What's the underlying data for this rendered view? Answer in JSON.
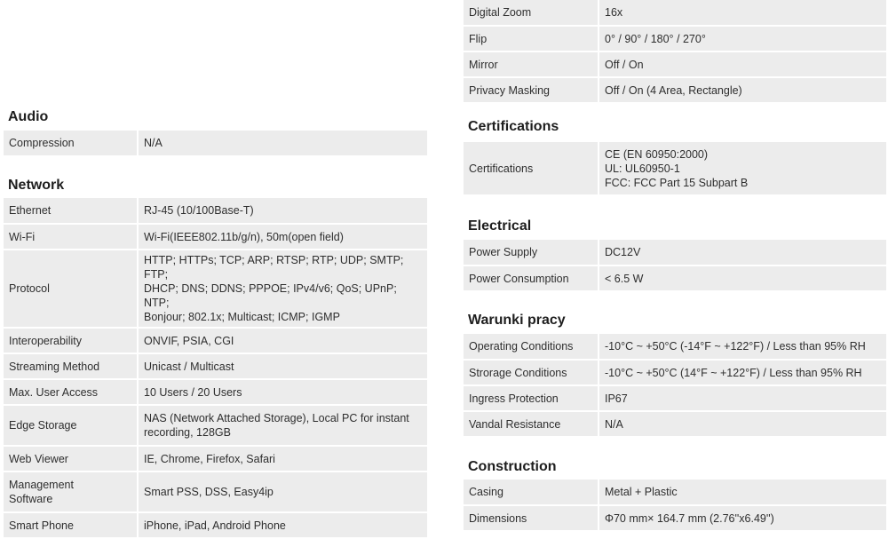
{
  "left": {
    "audio": {
      "title": "Audio",
      "rows": [
        {
          "label": "Compression",
          "value": "N/A"
        }
      ]
    },
    "network": {
      "title": "Network",
      "rows": [
        {
          "label": "Ethernet",
          "value": "RJ-45 (10/100Base-T)"
        },
        {
          "label": "Wi-Fi",
          "value": "Wi-Fi(IEEE802.11b/g/n), 50m(open field)"
        },
        {
          "label": "Protocol",
          "value": "HTTP; HTTPs; TCP; ARP; RTSP; RTP; UDP; SMTP; FTP;\nDHCP; DNS; DDNS; PPPOE; IPv4/v6; QoS; UPnP; NTP;\nBonjour; 802.1x; Multicast; ICMP; IGMP"
        },
        {
          "label": "Interoperability",
          "value": "ONVIF, PSIA, CGI"
        },
        {
          "label": "Streaming Method",
          "value": "Unicast / Multicast"
        },
        {
          "label": "Max. User Access",
          "value": "10 Users / 20 Users"
        },
        {
          "label": "Edge Storage",
          "value": "NAS (Network Attached Storage), Local PC for instant\nrecording, 128GB"
        },
        {
          "label": "Web Viewer",
          "value": "IE, Chrome, Firefox, Safari"
        },
        {
          "label": "Management\nSoftware",
          "value": "Smart PSS, DSS, Easy4ip"
        },
        {
          "label": "Smart Phone",
          "value": "iPhone, iPad, Android Phone"
        }
      ]
    }
  },
  "right": {
    "video": {
      "rows": [
        {
          "label": "Digital Zoom",
          "value": "16x"
        },
        {
          "label": "Flip",
          "value": "0° / 90° / 180° / 270°"
        },
        {
          "label": "Mirror",
          "value": "Off / On"
        },
        {
          "label": "Privacy Masking",
          "value": "Off / On (4 Area, Rectangle)"
        }
      ]
    },
    "certifications": {
      "title": "Certifications",
      "rows": [
        {
          "label": "Certifications",
          "value": "CE (EN 60950:2000)\nUL: UL60950-1\nFCC: FCC Part 15 Subpart B"
        }
      ]
    },
    "electrical": {
      "title": "Electrical",
      "rows": [
        {
          "label": "Power Supply",
          "value": "DC12V"
        },
        {
          "label": "Power Consumption",
          "value": "< 6.5 W"
        }
      ]
    },
    "environment": {
      "title": "Warunki pracy",
      "rows": [
        {
          "label": "Operating Conditions",
          "value": "-10°C ~ +50°C (-14°F ~ +122°F) / Less than 95% RH"
        },
        {
          "label": "Strorage Conditions",
          "value": "-10°C ~ +50°C (14°F ~ +122°F) / Less than 95% RH"
        },
        {
          "label": "Ingress Protection",
          "value": "IP67"
        },
        {
          "label": "Vandal Resistance",
          "value": "N/A"
        }
      ]
    },
    "construction": {
      "title": "Construction",
      "rows": [
        {
          "label": "Casing",
          "value": "Metal + Plastic"
        },
        {
          "label": "Dimensions",
          "value": "Φ70 mm× 164.7 mm (2.76''x6.49'')"
        }
      ]
    }
  }
}
